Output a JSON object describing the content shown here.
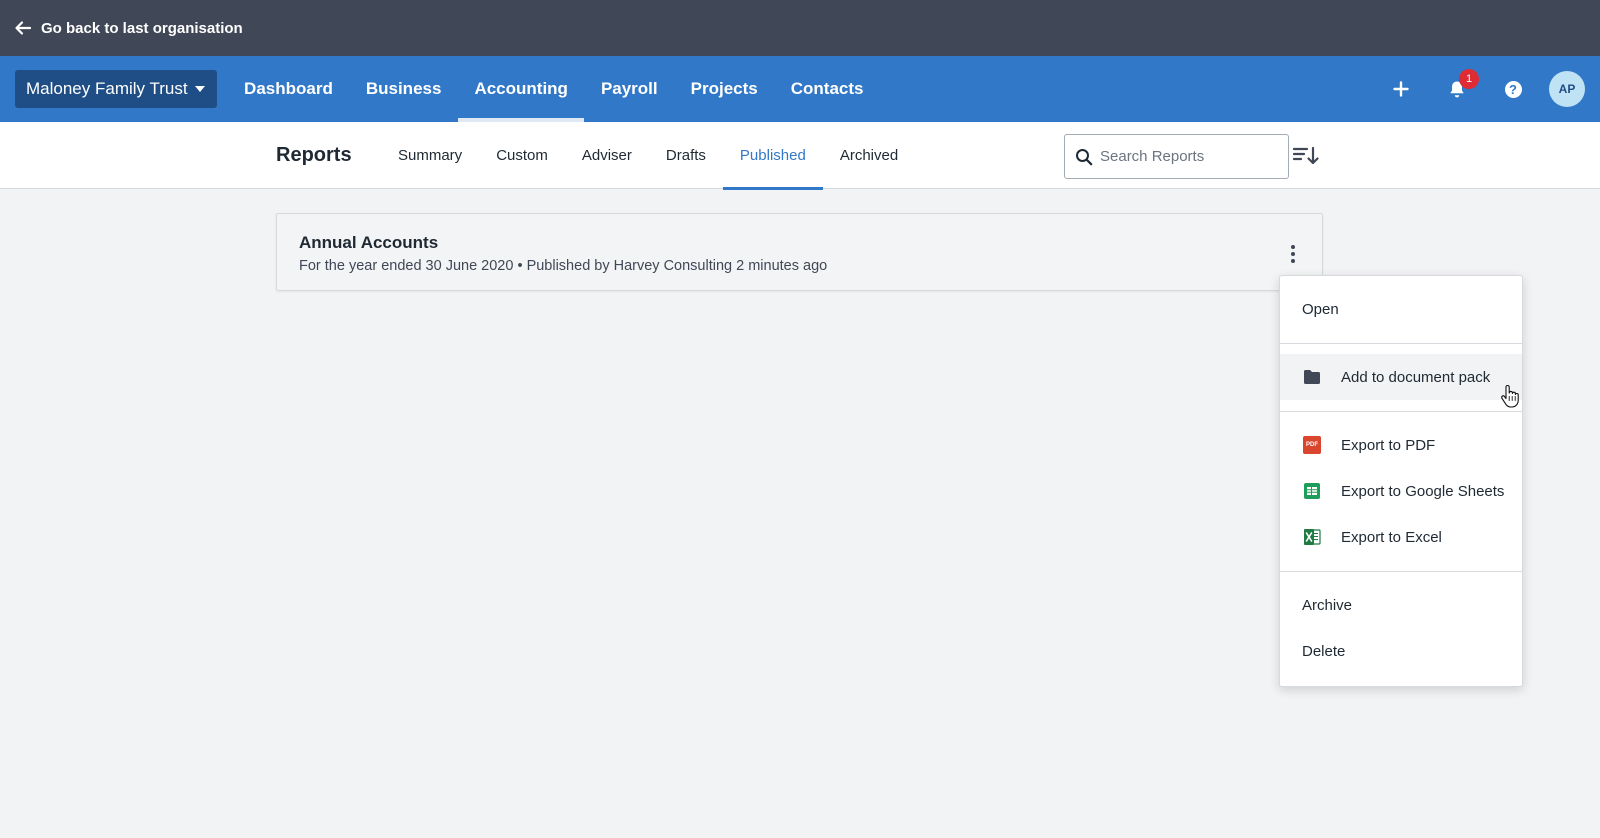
{
  "backbar": {
    "label": "Go back to last organisation"
  },
  "org": {
    "name": "Maloney Family Trust"
  },
  "nav": {
    "items": [
      {
        "label": "Dashboard"
      },
      {
        "label": "Business"
      },
      {
        "label": "Accounting"
      },
      {
        "label": "Payroll"
      },
      {
        "label": "Projects"
      },
      {
        "label": "Contacts"
      }
    ],
    "active": "Accounting",
    "notification_count": "1",
    "help_label": "?",
    "avatar_initials": "AP"
  },
  "reports": {
    "title": "Reports",
    "tabs": [
      {
        "label": "Summary"
      },
      {
        "label": "Custom"
      },
      {
        "label": "Adviser"
      },
      {
        "label": "Drafts"
      },
      {
        "label": "Published"
      },
      {
        "label": "Archived"
      }
    ],
    "active_tab": "Published",
    "search_placeholder": "Search Reports"
  },
  "report_card": {
    "title": "Annual Accounts",
    "meta": "For the year ended 30 June 2020 • Published by Harvey Consulting 2 minutes ago"
  },
  "menu": {
    "open": "Open",
    "add_to_pack": "Add to document pack",
    "export_pdf": "Export to PDF",
    "pdf_icon_text": "PDF",
    "export_sheets": "Export to Google Sheets",
    "export_excel": "Export to Excel",
    "archive": "Archive",
    "delete": "Delete"
  },
  "colors": {
    "topbar": "#404756",
    "nav": "#3278c8",
    "org_button": "#1f4e86",
    "accent": "#3278c8",
    "badge": "#de2b34",
    "pdf": "#d9452d",
    "sheets": "#1e9e5a",
    "excel": "#1f7a43"
  }
}
